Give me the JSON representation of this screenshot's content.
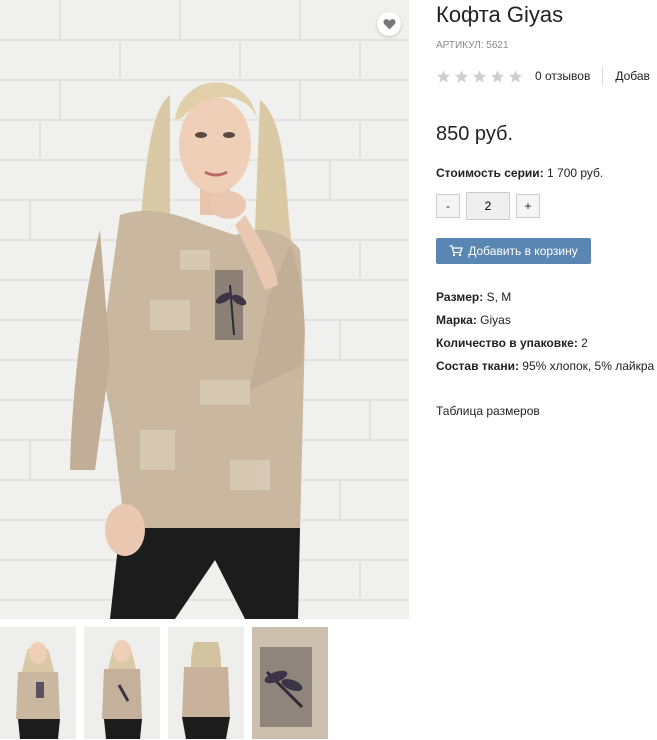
{
  "product": {
    "title": "Кофта Giyas",
    "sku": "АРТИКУЛ: 5621",
    "rating": 0,
    "max_rating": 5,
    "reviews_label": "0 отзывов",
    "add_review_label": "Добав",
    "price": "850 руб.",
    "series_label": "Стоимость серии:",
    "series_value": "1 700 руб.",
    "quantity": "2",
    "minus_label": "-",
    "plus_label": "+",
    "add_to_cart_label": "Добавить в корзину",
    "properties": [
      {
        "label": "Размер:",
        "value": "S, M"
      },
      {
        "label": "Марка:",
        "value": "Giyas"
      },
      {
        "label": "Количество в упаковке:",
        "value": "2"
      },
      {
        "label": "Состав ткани:",
        "value": "95% хлопок, 5% лайкра"
      }
    ],
    "size_table_label": "Таблица размеров"
  },
  "icons": {
    "favorite": "heart-icon",
    "cart": "shopping-cart-icon",
    "star": "star-icon"
  },
  "colors": {
    "accent_button": "#5a86b4",
    "star_empty": "#cfcfcf",
    "garment": "#c7b49e",
    "pants": "#1c1c1c"
  }
}
